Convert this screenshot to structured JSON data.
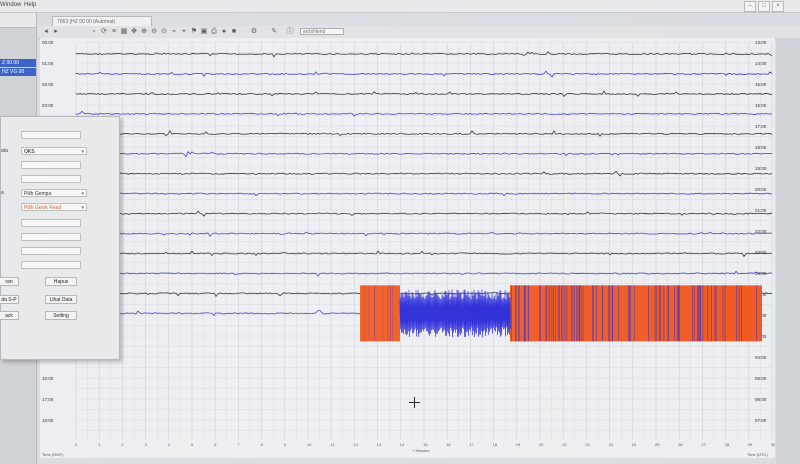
{
  "menu": {
    "items": [
      "Window",
      "Help"
    ]
  },
  "window_controls": {
    "minimize": "–",
    "maximize": "□",
    "close": "×"
  },
  "document_tab": {
    "label": "7063 (HZ 00 00 (Automat)"
  },
  "left_stations": [
    "Z 00 00",
    "HZ VG 00"
  ],
  "toolbar": {
    "field_value": "wctshlend"
  },
  "plot": {
    "left_time_labels": [
      "00:00",
      "01:00",
      "02:00",
      "03:00",
      "04:00",
      "05:00",
      "06:00",
      "07:00",
      "08:00",
      "09:00",
      "10:00",
      "11:00",
      "12:00",
      "13:00",
      "14:00",
      "15:00",
      "16:00",
      "17:00",
      "18:00"
    ],
    "right_time_labels": [
      "13:00",
      "14:00",
      "15:00",
      "16:00",
      "17:00",
      "18:00",
      "19:00",
      "20:00",
      "21:00",
      "22:00",
      "23:00",
      "00:00",
      "01:00",
      "02:00",
      "03:00",
      "04:00",
      "05:00",
      "06:00",
      "07:00"
    ],
    "x_ticks": [
      "0",
      "1",
      "2",
      "3",
      "4",
      "5",
      "6",
      "7",
      "8",
      "9",
      "10",
      "11",
      "12",
      "13",
      "14",
      "15",
      "16",
      "17",
      "18",
      "19",
      "20",
      "21",
      "22",
      "23",
      "24",
      "25",
      "26",
      "27",
      "28",
      "29",
      "30"
    ],
    "x_axis_label": "+ Minutes",
    "bottom_left_label": "Time (GMT)",
    "bottom_right_label": "Time (UTC)",
    "trace_colors": [
      "#2f2f3a",
      "#3a3fc8"
    ],
    "event_colors": [
      "#f05a22",
      "#2a2ad8"
    ]
  },
  "dialog": {
    "fields": [
      "",
      "OKS",
      "",
      "",
      "Pilih Gempa",
      "Pilih Gelok Read",
      "",
      "",
      "",
      ""
    ],
    "labels": [
      "ata",
      "",
      "a"
    ],
    "buttons": {
      "left": [
        "ran",
        "da S-P",
        "ack"
      ],
      "right": [
        "Hapus",
        "Lihat Data",
        "Setting"
      ]
    }
  }
}
